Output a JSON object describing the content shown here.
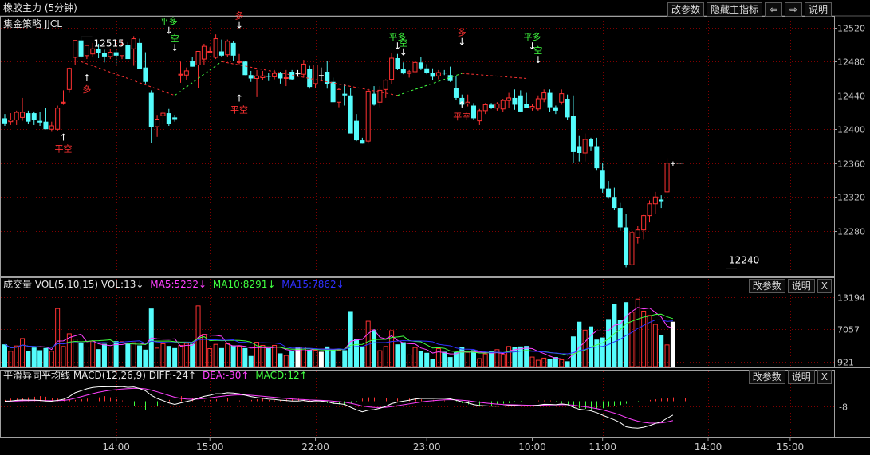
{
  "header": {
    "title": "橡胶主力 (5分钟)",
    "toolbar": {
      "params": "改参数",
      "hide_indicator": "隐藏主指标",
      "prev_arrow": "⇦",
      "next_arrow": "⇨",
      "help": "说明"
    }
  },
  "main_panel": {
    "indicator_label": "集金策略 JJCL",
    "high_label": "12515",
    "low_label": "12240"
  },
  "vol_panel": {
    "label": "成交量 VOL(5,10,15) VOL:13↓",
    "ma5": "MA5:5232↓",
    "ma10": "MA10:8291↓",
    "ma15": "MA15:7862↓",
    "params": "改参数",
    "help": "说明",
    "close": "X"
  },
  "macd_panel": {
    "label": "平滑异同平均线 MACD(12,26,9) DIFF:-24↑",
    "dea": "DEA:-30↑",
    "macd": "MACD:12↑",
    "params": "改参数",
    "help": "说明",
    "close": "X"
  },
  "colors": {
    "up": "#ff3232",
    "down": "#54fcfc",
    "flat": "#ffffff",
    "ma5": "#ff40ff",
    "ma10": "#40ff40",
    "ma15": "#3030ff",
    "signal_long": "#ff3232",
    "signal_short": "#40ff40",
    "grid": "#800000"
  },
  "chart_data": {
    "type": "candlestick",
    "price_axis": {
      "ticks": [
        12520,
        12480,
        12440,
        12400,
        12360,
        12320,
        12280
      ],
      "ylim": [
        12228,
        12532
      ]
    },
    "time_axis": {
      "labels": [
        "14:00",
        "15:00",
        "22:00",
        "23:00",
        "10:00",
        "11:00",
        "14:00",
        "15:00"
      ],
      "label_bars": [
        19,
        35,
        53,
        72,
        90,
        102,
        120,
        134
      ]
    },
    "candles": [
      [
        12413,
        12418,
        12404,
        12407
      ],
      [
        12409,
        12419,
        12405,
        12411
      ],
      [
        12411,
        12422,
        12405,
        12420
      ],
      [
        12414,
        12437,
        12410,
        12420
      ],
      [
        12419,
        12422,
        12406,
        12409
      ],
      [
        12419,
        12421,
        12405,
        12411
      ],
      [
        12410,
        12420,
        12404,
        12408
      ],
      [
        12409,
        12425,
        12402,
        12400
      ],
      [
        12400,
        12409,
        12397,
        12404
      ],
      [
        12400,
        12428,
        12398,
        12425
      ],
      [
        12431,
        12446,
        12429,
        12432
      ],
      [
        12447,
        12473,
        12443,
        12472
      ],
      [
        12485,
        12505,
        12476,
        12505
      ],
      [
        12505,
        12509,
        12484,
        12486
      ],
      [
        12487,
        12500,
        12483,
        12499
      ],
      [
        12489,
        12502,
        12485,
        12495
      ],
      [
        12495,
        12501,
        12484,
        12490
      ],
      [
        12490,
        12494,
        12479,
        12486
      ],
      [
        12486,
        12495,
        12483,
        12491
      ],
      [
        12491,
        12494,
        12476,
        12487
      ],
      [
        12487,
        12506,
        12483,
        12500
      ],
      [
        12500,
        12503,
        12483,
        12483
      ],
      [
        12495,
        12510,
        12475,
        12507
      ],
      [
        12502,
        12507,
        12471,
        12471
      ],
      [
        12473,
        12491,
        12454,
        12456
      ],
      [
        12443,
        12446,
        12384,
        12403
      ],
      [
        12403,
        12417,
        12391,
        12412
      ],
      [
        12416,
        12422,
        12406,
        12419
      ],
      [
        12419,
        12424,
        12404,
        12406
      ],
      [
        12414,
        12417,
        12409,
        12412
      ],
      [
        12464,
        12480,
        12455,
        12465
      ],
      [
        12464,
        12473,
        12458,
        12469
      ],
      [
        12481,
        12485,
        12474,
        12474
      ],
      [
        12476,
        12491,
        12449,
        12492
      ],
      [
        12483,
        12501,
        12476,
        12498
      ],
      [
        12491,
        12497,
        12491,
        12492
      ],
      [
        12485,
        12512,
        12483,
        12507
      ],
      [
        12492,
        12506,
        12485,
        12487
      ],
      [
        12488,
        12506,
        12485,
        12504
      ],
      [
        12502,
        12504,
        12481,
        12487
      ],
      [
        12479,
        12489,
        12477,
        12480
      ],
      [
        12480,
        12481,
        12464,
        12464
      ],
      [
        12464,
        12469,
        12456,
        12460
      ],
      [
        12460,
        12470,
        12438,
        12463
      ],
      [
        12461,
        12469,
        12458,
        12463
      ],
      [
        12463,
        12467,
        12457,
        12462
      ],
      [
        12462,
        12470,
        12459,
        12466
      ],
      [
        12466,
        12468,
        12454,
        12460
      ],
      [
        12460,
        12470,
        12451,
        12461
      ],
      [
        12468,
        12470,
        12458,
        12459
      ],
      [
        12466,
        12470,
        12462,
        12466
      ],
      [
        12465,
        12482,
        12461,
        12477
      ],
      [
        12471,
        12475,
        12448,
        12450
      ],
      [
        12454,
        12476,
        12449,
        12476
      ],
      [
        12464,
        12473,
        12457,
        12464
      ],
      [
        12468,
        12481,
        12448,
        12453
      ],
      [
        12456,
        12461,
        12432,
        12432
      ],
      [
        12432,
        12449,
        12426,
        12447
      ],
      [
        12442,
        12453,
        12428,
        12440
      ],
      [
        12440,
        12449,
        12395,
        12395
      ],
      [
        12410,
        12418,
        12386,
        12387
      ],
      [
        12387,
        12390,
        12383,
        12383
      ],
      [
        12386,
        12448,
        12383,
        12445
      ],
      [
        12442,
        12451,
        12428,
        12429
      ],
      [
        12432,
        12451,
        12426,
        12446
      ],
      [
        12447,
        12459,
        12437,
        12458
      ],
      [
        12459,
        12490,
        12453,
        12484
      ],
      [
        12484,
        12489,
        12470,
        12471
      ],
      [
        12471,
        12479,
        12465,
        12466
      ],
      [
        12466,
        12470,
        12461,
        12468
      ],
      [
        12468,
        12480,
        12464,
        12479
      ],
      [
        12479,
        12485,
        12470,
        12472
      ],
      [
        12472,
        12477,
        12465,
        12467
      ],
      [
        12467,
        12472,
        12458,
        12462
      ],
      [
        12463,
        12470,
        12459,
        12467
      ],
      [
        12467,
        12470,
        12464,
        12466
      ],
      [
        12464,
        12474,
        12456,
        12457
      ],
      [
        12449,
        12463,
        12435,
        12437
      ],
      [
        12437,
        12441,
        12427,
        12429
      ],
      [
        12430,
        12441,
        12427,
        12432
      ],
      [
        12428,
        12431,
        12411,
        12413
      ],
      [
        12410,
        12424,
        12405,
        12422
      ],
      [
        12422,
        12431,
        12418,
        12429
      ],
      [
        12429,
        12431,
        12424,
        12425
      ],
      [
        12425,
        12432,
        12422,
        12430
      ],
      [
        12424,
        12436,
        12420,
        12434
      ],
      [
        12434,
        12443,
        12425,
        12437
      ],
      [
        12437,
        12447,
        12423,
        12429
      ],
      [
        12440,
        12446,
        12420,
        12421
      ],
      [
        12430,
        12443,
        12425,
        12425
      ],
      [
        12425,
        12430,
        12422,
        12427
      ],
      [
        12424,
        12440,
        12422,
        12436
      ],
      [
        12436,
        12447,
        12432,
        12443
      ],
      [
        12443,
        12447,
        12420,
        12426
      ],
      [
        12426,
        12428,
        12418,
        12422
      ],
      [
        12432,
        12447,
        12429,
        12442
      ],
      [
        12436,
        12441,
        12411,
        12414
      ],
      [
        12416,
        12440,
        12360,
        12373
      ],
      [
        12380,
        12392,
        12362,
        12372
      ],
      [
        12372,
        12395,
        12362,
        12388
      ],
      [
        12388,
        12390,
        12375,
        12380
      ],
      [
        12380,
        12390,
        12352,
        12354
      ],
      [
        12352,
        12360,
        12325,
        12330
      ],
      [
        12330,
        12339,
        12318,
        12320
      ],
      [
        12320,
        12331,
        12305,
        12307
      ],
      [
        12307,
        12313,
        12280,
        12284
      ],
      [
        12284,
        12300,
        12237,
        12240
      ],
      [
        12240,
        12282,
        12238,
        12278
      ],
      [
        12272,
        12286,
        12265,
        12281
      ],
      [
        12281,
        12299,
        12270,
        12298
      ],
      [
        12298,
        12316,
        12290,
        12312
      ],
      [
        12312,
        12326,
        12300,
        12320
      ],
      [
        12317,
        12322,
        12307,
        12315
      ],
      [
        12326,
        12366,
        12325,
        12360
      ],
      [
        12360,
        12362,
        12357,
        12360
      ]
    ],
    "volume_axis": {
      "ticks": [
        13194,
        7057,
        921
      ],
      "ylim": [
        0,
        14800
      ]
    },
    "volume": [
      4200,
      2900,
      3900,
      5300,
      3000,
      3600,
      3100,
      3500,
      2900,
      11000,
      3800,
      6200,
      5200,
      4500,
      3700,
      4800,
      3300,
      4300,
      3700,
      4800,
      4700,
      4400,
      4500,
      4000,
      3200,
      11000,
      3500,
      4300,
      3900,
      3500,
      4000,
      4400,
      4300,
      11500,
      6100,
      3400,
      4200,
      3500,
      4300,
      4000,
      3800,
      3500,
      2000,
      4600,
      4000,
      3500,
      4000,
      2500,
      2100,
      2900,
      3700,
      3700,
      3200,
      3100,
      2800,
      3800,
      3300,
      3100,
      3100,
      10500,
      5200,
      3800,
      8600,
      7000,
      3000,
      3800,
      6800,
      4200,
      4600,
      2200,
      3600,
      3000,
      2600,
      1400,
      3400,
      2800,
      1800,
      2700,
      3700,
      2700,
      3100,
      1500,
      2400,
      3000,
      3200,
      2300,
      3800,
      3700,
      3800,
      3900,
      1800,
      1200,
      1600,
      1400,
      1800,
      1300,
      1000,
      5700,
      8500,
      6900,
      7600,
      5100,
      5500,
      9000,
      11900,
      8800,
      12200,
      10300,
      12800,
      10500,
      9700,
      8000,
      6000,
      4100,
      8500
    ],
    "macd_axis": {
      "ticks": [
        -8
      ],
      "ylim": [
        -56,
        32
      ]
    },
    "macd_hist": [
      2,
      4,
      4,
      5,
      6,
      7,
      8,
      7,
      5,
      4,
      3,
      2,
      2,
      3,
      4,
      5,
      6,
      8,
      6,
      3,
      1,
      -2,
      -7,
      -13,
      -14,
      -11,
      -8,
      -3,
      2,
      6,
      8,
      7,
      5,
      4,
      1,
      2,
      3,
      6,
      5,
      3,
      1,
      0,
      2,
      3,
      4,
      2,
      1,
      2,
      3,
      4,
      4,
      3,
      1,
      0,
      -1,
      -3,
      -4,
      -5,
      -6,
      -4,
      -1,
      4,
      6,
      6,
      5,
      5,
      5,
      4,
      4,
      4,
      4,
      3,
      3,
      2,
      2,
      1,
      0,
      -1,
      -3,
      -5,
      -6,
      -8,
      -9,
      -7,
      -5,
      -4,
      -3,
      -2,
      -1,
      0,
      1,
      1,
      1,
      1,
      -1,
      -3,
      -6,
      -9,
      -11,
      -12,
      -13,
      -12,
      -11,
      -9,
      -8,
      -6,
      -4,
      -3,
      -2,
      0,
      2,
      3,
      4,
      5,
      6,
      6,
      5,
      4
    ]
  }
}
